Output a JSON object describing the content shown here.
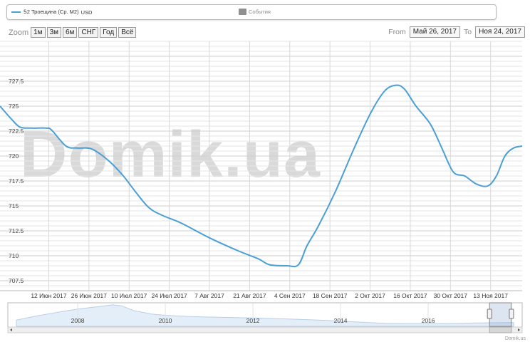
{
  "legend": {
    "series_label": "Ꭶ2 Троещина (Ср. М2)",
    "series_unit": "USD",
    "events_label": "События"
  },
  "zoom": {
    "label": "Zoom",
    "buttons": [
      "1м",
      "3м",
      "6м",
      "СНГ",
      "Год",
      "Всё"
    ]
  },
  "range": {
    "from_label": "From",
    "from_value": "Май 26, 2017",
    "to_label": "To",
    "to_value": "Ноя 24, 2017"
  },
  "watermark": "Domik.ua",
  "credit": "Domik.us",
  "colors": {
    "series": "#4a9fd5",
    "grid": "#d8d8d8",
    "navigator_fill": "#e3eef8",
    "navigator_line": "#b9cfe4"
  },
  "chart_data": {
    "type": "line",
    "title": "",
    "xlabel": "",
    "ylabel": "",
    "x_start": "2017-05-26",
    "x_end": "2017-11-24",
    "ylim": [
      706.5,
      731.5
    ],
    "y_ticks": [
      707.5,
      710,
      712.5,
      715,
      717.5,
      720,
      722.5,
      725,
      727.5
    ],
    "x_ticks": [
      {
        "date": "2017-06-12",
        "label": "12 Июн 2017"
      },
      {
        "date": "2017-06-26",
        "label": "26 Июн 2017"
      },
      {
        "date": "2017-07-10",
        "label": "10 Июл 2017"
      },
      {
        "date": "2017-07-24",
        "label": "24 Июл 2017"
      },
      {
        "date": "2017-08-07",
        "label": "7 Авг 2017"
      },
      {
        "date": "2017-08-21",
        "label": "21 Авг 2017"
      },
      {
        "date": "2017-09-04",
        "label": "4 Сен 2017"
      },
      {
        "date": "2017-09-18",
        "label": "18 Сен 2017"
      },
      {
        "date": "2017-10-02",
        "label": "2 Окт 2017"
      },
      {
        "date": "2017-10-16",
        "label": "16 Окт 2017"
      },
      {
        "date": "2017-10-30",
        "label": "30 Окт 2017"
      },
      {
        "date": "2017-11-13",
        "label": "13 Ноя 2017"
      }
    ],
    "series": [
      {
        "name": "Ꭶ2 Троещина (Ср. М2)",
        "points": [
          [
            "2017-05-26",
            725.0
          ],
          [
            "2017-05-30",
            723.7
          ],
          [
            "2017-06-02",
            722.9
          ],
          [
            "2017-06-06",
            722.8
          ],
          [
            "2017-06-11",
            722.8
          ],
          [
            "2017-06-13",
            722.6
          ],
          [
            "2017-06-18",
            721.0
          ],
          [
            "2017-06-22",
            720.8
          ],
          [
            "2017-06-27",
            720.7
          ],
          [
            "2017-07-03",
            719.5
          ],
          [
            "2017-07-08",
            718.0
          ],
          [
            "2017-07-12",
            716.5
          ],
          [
            "2017-07-17",
            714.8
          ],
          [
            "2017-07-22",
            714.0
          ],
          [
            "2017-07-28",
            713.3
          ],
          [
            "2017-08-07",
            711.8
          ],
          [
            "2017-08-17",
            710.5
          ],
          [
            "2017-08-24",
            709.7
          ],
          [
            "2017-08-28",
            709.1
          ],
          [
            "2017-09-03",
            709.0
          ],
          [
            "2017-09-07",
            709.1
          ],
          [
            "2017-09-10",
            711.0
          ],
          [
            "2017-09-14",
            713.0
          ],
          [
            "2017-09-20",
            716.5
          ],
          [
            "2017-09-26",
            720.5
          ],
          [
            "2017-10-02",
            724.2
          ],
          [
            "2017-10-07",
            726.5
          ],
          [
            "2017-10-11",
            727.1
          ],
          [
            "2017-10-14",
            726.7
          ],
          [
            "2017-10-18",
            725.0
          ],
          [
            "2017-10-23",
            723.2
          ],
          [
            "2017-10-27",
            720.8
          ],
          [
            "2017-10-31",
            718.4
          ],
          [
            "2017-11-04",
            718.0
          ],
          [
            "2017-11-08",
            717.2
          ],
          [
            "2017-11-12",
            717.0
          ],
          [
            "2017-11-15",
            718.0
          ],
          [
            "2017-11-18",
            720.0
          ],
          [
            "2017-11-21",
            720.8
          ],
          [
            "2017-11-24",
            721.0
          ]
        ]
      }
    ],
    "navigator": {
      "year_labels": [
        "2008",
        "2010",
        "2012",
        "2014",
        "2016"
      ],
      "year_start": 2006.6,
      "year_end": 2017.95,
      "profile": [
        [
          2006.6,
          0.28
        ],
        [
          2007.0,
          0.45
        ],
        [
          2007.5,
          0.62
        ],
        [
          2008.0,
          0.78
        ],
        [
          2008.5,
          0.9
        ],
        [
          2008.8,
          0.97
        ],
        [
          2009.0,
          0.93
        ],
        [
          2009.3,
          0.7
        ],
        [
          2009.7,
          0.55
        ],
        [
          2010.0,
          0.5
        ],
        [
          2010.5,
          0.45
        ],
        [
          2011.0,
          0.42
        ],
        [
          2011.5,
          0.4
        ],
        [
          2012.0,
          0.38
        ],
        [
          2012.5,
          0.35
        ],
        [
          2013.0,
          0.32
        ],
        [
          2013.5,
          0.28
        ],
        [
          2014.0,
          0.24
        ],
        [
          2014.5,
          0.18
        ],
        [
          2015.0,
          0.14
        ],
        [
          2015.5,
          0.12
        ],
        [
          2016.0,
          0.12
        ],
        [
          2016.5,
          0.13
        ],
        [
          2017.0,
          0.15
        ],
        [
          2017.5,
          0.16
        ],
        [
          2017.95,
          0.17
        ]
      ],
      "selection_start": 2017.4,
      "selection_end": 2017.9
    }
  }
}
